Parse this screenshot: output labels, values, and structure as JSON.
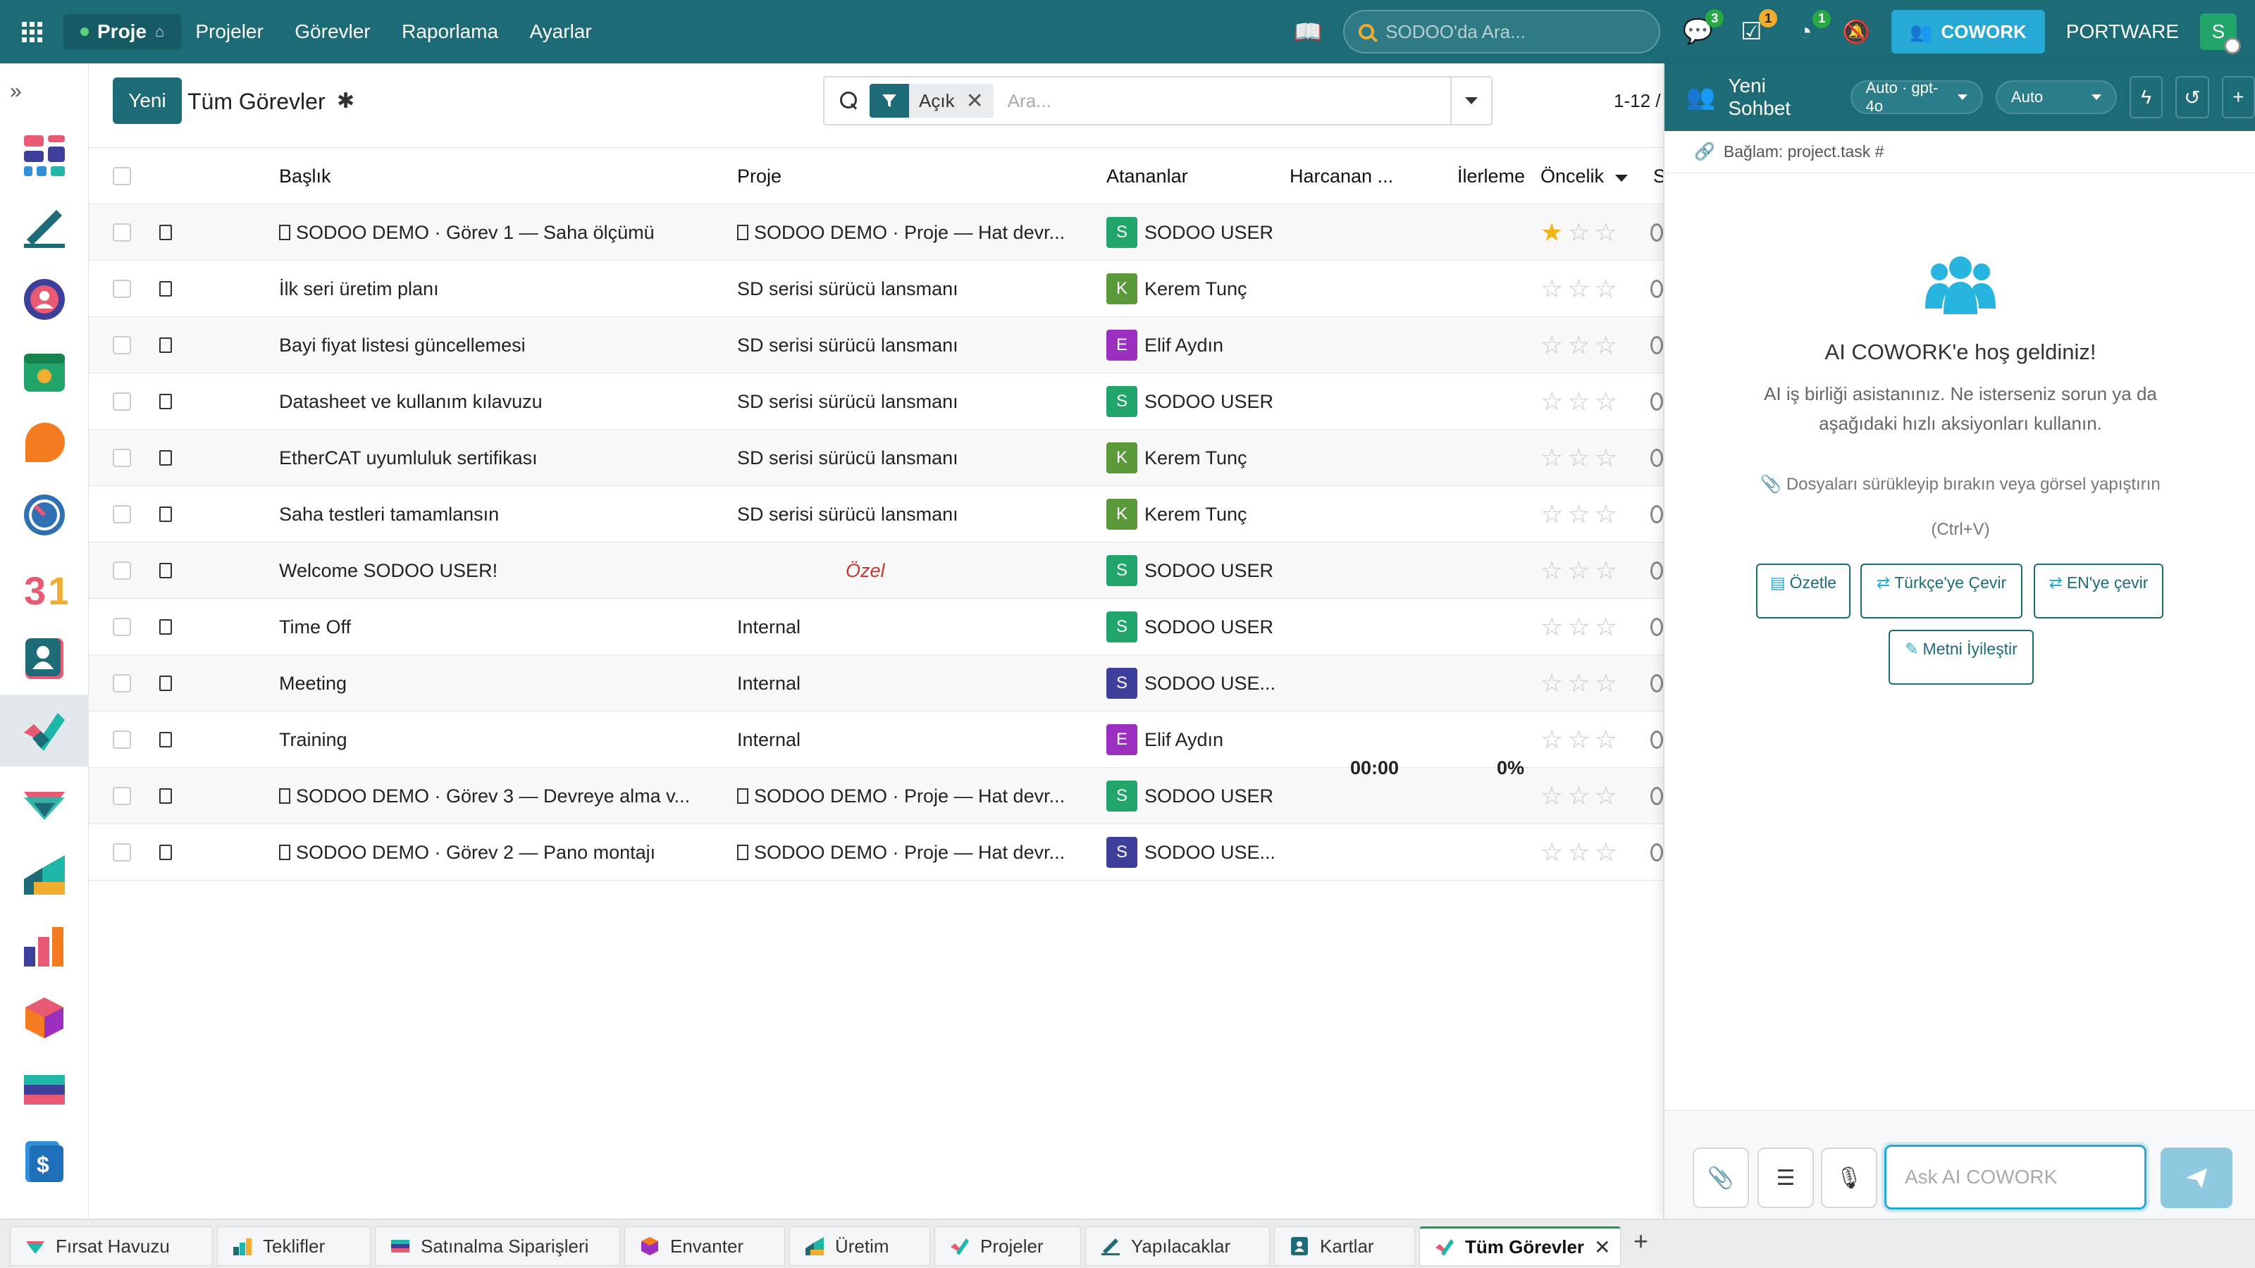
{
  "navbar": {
    "app_name": "Proje",
    "menu": [
      "Projeler",
      "Görevler",
      "Raporlama",
      "Ayarlar"
    ],
    "search_placeholder": "SODOO'da Ara...",
    "badges": {
      "messages": "3",
      "activities": "1",
      "timer": "1"
    },
    "cowork_label": "COWORK",
    "company": "PORTWARE",
    "user_initial": "S",
    "colors": {
      "primary": "#1d6b77",
      "cowork": "#27a9d6",
      "badge_green": "#28a745",
      "badge_orange": "#f0ad2f"
    }
  },
  "sidebar": {
    "expand_symbol": "»",
    "apps": [
      "dashboard-app",
      "notes-app",
      "discuss-app",
      "calendar-app",
      "crm-app",
      "time-app",
      "calendar-31-app",
      "contacts-app",
      "project-app",
      "sales-app",
      "inventory-app",
      "manufacturing-app",
      "product-app",
      "purchase-app",
      "invoicing-app"
    ],
    "active_app": "project-app"
  },
  "control": {
    "new_label": "Yeni",
    "title": "Tüm Görevler",
    "facet_label": "Açık",
    "search_placeholder": "Ara...",
    "pager": "1-12 /"
  },
  "list": {
    "columns": {
      "title": "Başlık",
      "project": "Proje",
      "assignees": "Atananlar",
      "spent": "Harcanan ...",
      "progress": "İlerleme",
      "priority": "Öncelik",
      "stage_cut": "S"
    },
    "rows": [
      {
        "title": "SODOO DEMO · Görev 1 — Saha ölçümü",
        "title_box": true,
        "project": "SODOO DEMO · Proje — Hat devr...",
        "project_box": true,
        "project_private": false,
        "assignee": "SODOO USER",
        "initial": "S",
        "avatar_color": "#21a56b",
        "stars": 1
      },
      {
        "title": "İlk seri üretim planı",
        "title_box": false,
        "project": "SD serisi sürücü lansmanı",
        "project_box": false,
        "project_private": false,
        "assignee": "Kerem Tunç",
        "initial": "K",
        "avatar_color": "#5a9a3a",
        "stars": 0
      },
      {
        "title": "Bayi fiyat listesi güncellemesi",
        "title_box": false,
        "project": "SD serisi sürücü lansmanı",
        "project_box": false,
        "project_private": false,
        "assignee": "Elif Aydın",
        "initial": "E",
        "avatar_color": "#9b2fc0",
        "stars": 0
      },
      {
        "title": "Datasheet ve kullanım kılavuzu",
        "title_box": false,
        "project": "SD serisi sürücü lansmanı",
        "project_box": false,
        "project_private": false,
        "assignee": "SODOO USER",
        "initial": "S",
        "avatar_color": "#21a56b",
        "stars": 0
      },
      {
        "title": "EtherCAT uyumluluk sertifikası",
        "title_box": false,
        "project": "SD serisi sürücü lansmanı",
        "project_box": false,
        "project_private": false,
        "assignee": "Kerem Tunç",
        "initial": "K",
        "avatar_color": "#5a9a3a",
        "stars": 0
      },
      {
        "title": "Saha testleri tamamlansın",
        "title_box": false,
        "project": "SD serisi sürücü lansmanı",
        "project_box": false,
        "project_private": false,
        "assignee": "Kerem Tunç",
        "initial": "K",
        "avatar_color": "#5a9a3a",
        "stars": 0
      },
      {
        "title": "Welcome SODOO USER!",
        "title_box": false,
        "project": "Özel",
        "project_box": false,
        "project_private": true,
        "assignee": "SODOO USER",
        "initial": "S",
        "avatar_color": "#21a56b",
        "stars": 0
      },
      {
        "title": "Time Off",
        "title_box": false,
        "project": "Internal",
        "project_box": false,
        "project_private": false,
        "assignee": "SODOO USER",
        "initial": "S",
        "avatar_color": "#21a56b",
        "stars": 0
      },
      {
        "title": "Meeting",
        "title_box": false,
        "project": "Internal",
        "project_box": false,
        "project_private": false,
        "assignee": "SODOO USE...",
        "initial": "S",
        "avatar_color": "#3d3f9a",
        "stars": 0
      },
      {
        "title": "Training",
        "title_box": false,
        "project": "Internal",
        "project_box": false,
        "project_private": false,
        "assignee": "Elif Aydın",
        "initial": "E",
        "avatar_color": "#9b2fc0",
        "stars": 0
      },
      {
        "title": "SODOO DEMO · Görev 3 — Devreye alma v...",
        "title_box": true,
        "project": "SODOO DEMO · Proje — Hat devr...",
        "project_box": true,
        "project_private": false,
        "assignee": "SODOO USER",
        "initial": "S",
        "avatar_color": "#21a56b",
        "stars": 0
      },
      {
        "title": "SODOO DEMO · Görev 2 — Pano montajı",
        "title_box": true,
        "project": "SODOO DEMO · Proje — Hat devr...",
        "project_box": true,
        "project_private": false,
        "assignee": "SODOO USE...",
        "initial": "S",
        "avatar_color": "#3d3f9a",
        "stars": 0
      }
    ],
    "totals": {
      "spent": "00:00",
      "progress": "0%"
    }
  },
  "chat": {
    "title": "Yeni Sohbet",
    "model_pill": "Auto · gpt-4o",
    "mode_pill": "Auto",
    "context": "Bağlam: project.task #",
    "welcome_title": "AI COWORK'e hoş geldiniz!",
    "welcome_desc": "AI iş birliği asistanınız. Ne isterseniz sorun ya da aşağıdaki hızlı aksiyonları kullanın.",
    "drop_hint": "Dosyaları sürükleyip bırakın veya görsel yapıştırın",
    "paste_hint": "(Ctrl+V)",
    "quick_actions": [
      "Özetle",
      "Türkçe'ye Çevir",
      "EN'ye çevir",
      "Metni İyileştir"
    ],
    "input_placeholder": "Ask AI COWORK"
  },
  "tabs": {
    "items": [
      {
        "label": "Fırsat Havuzu",
        "icon": "crm-pipeline-icon"
      },
      {
        "label": "Teklifler",
        "icon": "quotations-icon"
      },
      {
        "label": "Satınalma Siparişleri",
        "icon": "purchase-orders-icon"
      },
      {
        "label": "Envanter",
        "icon": "inventory-icon"
      },
      {
        "label": "Üretim",
        "icon": "manufacturing-icon"
      },
      {
        "label": "Projeler",
        "icon": "projects-icon"
      },
      {
        "label": "Yapılacaklar",
        "icon": "todo-icon"
      },
      {
        "label": "Kartlar",
        "icon": "cards-icon"
      },
      {
        "label": "Tüm Görevler",
        "icon": "all-tasks-icon"
      }
    ],
    "active": "Tüm Görevler"
  }
}
